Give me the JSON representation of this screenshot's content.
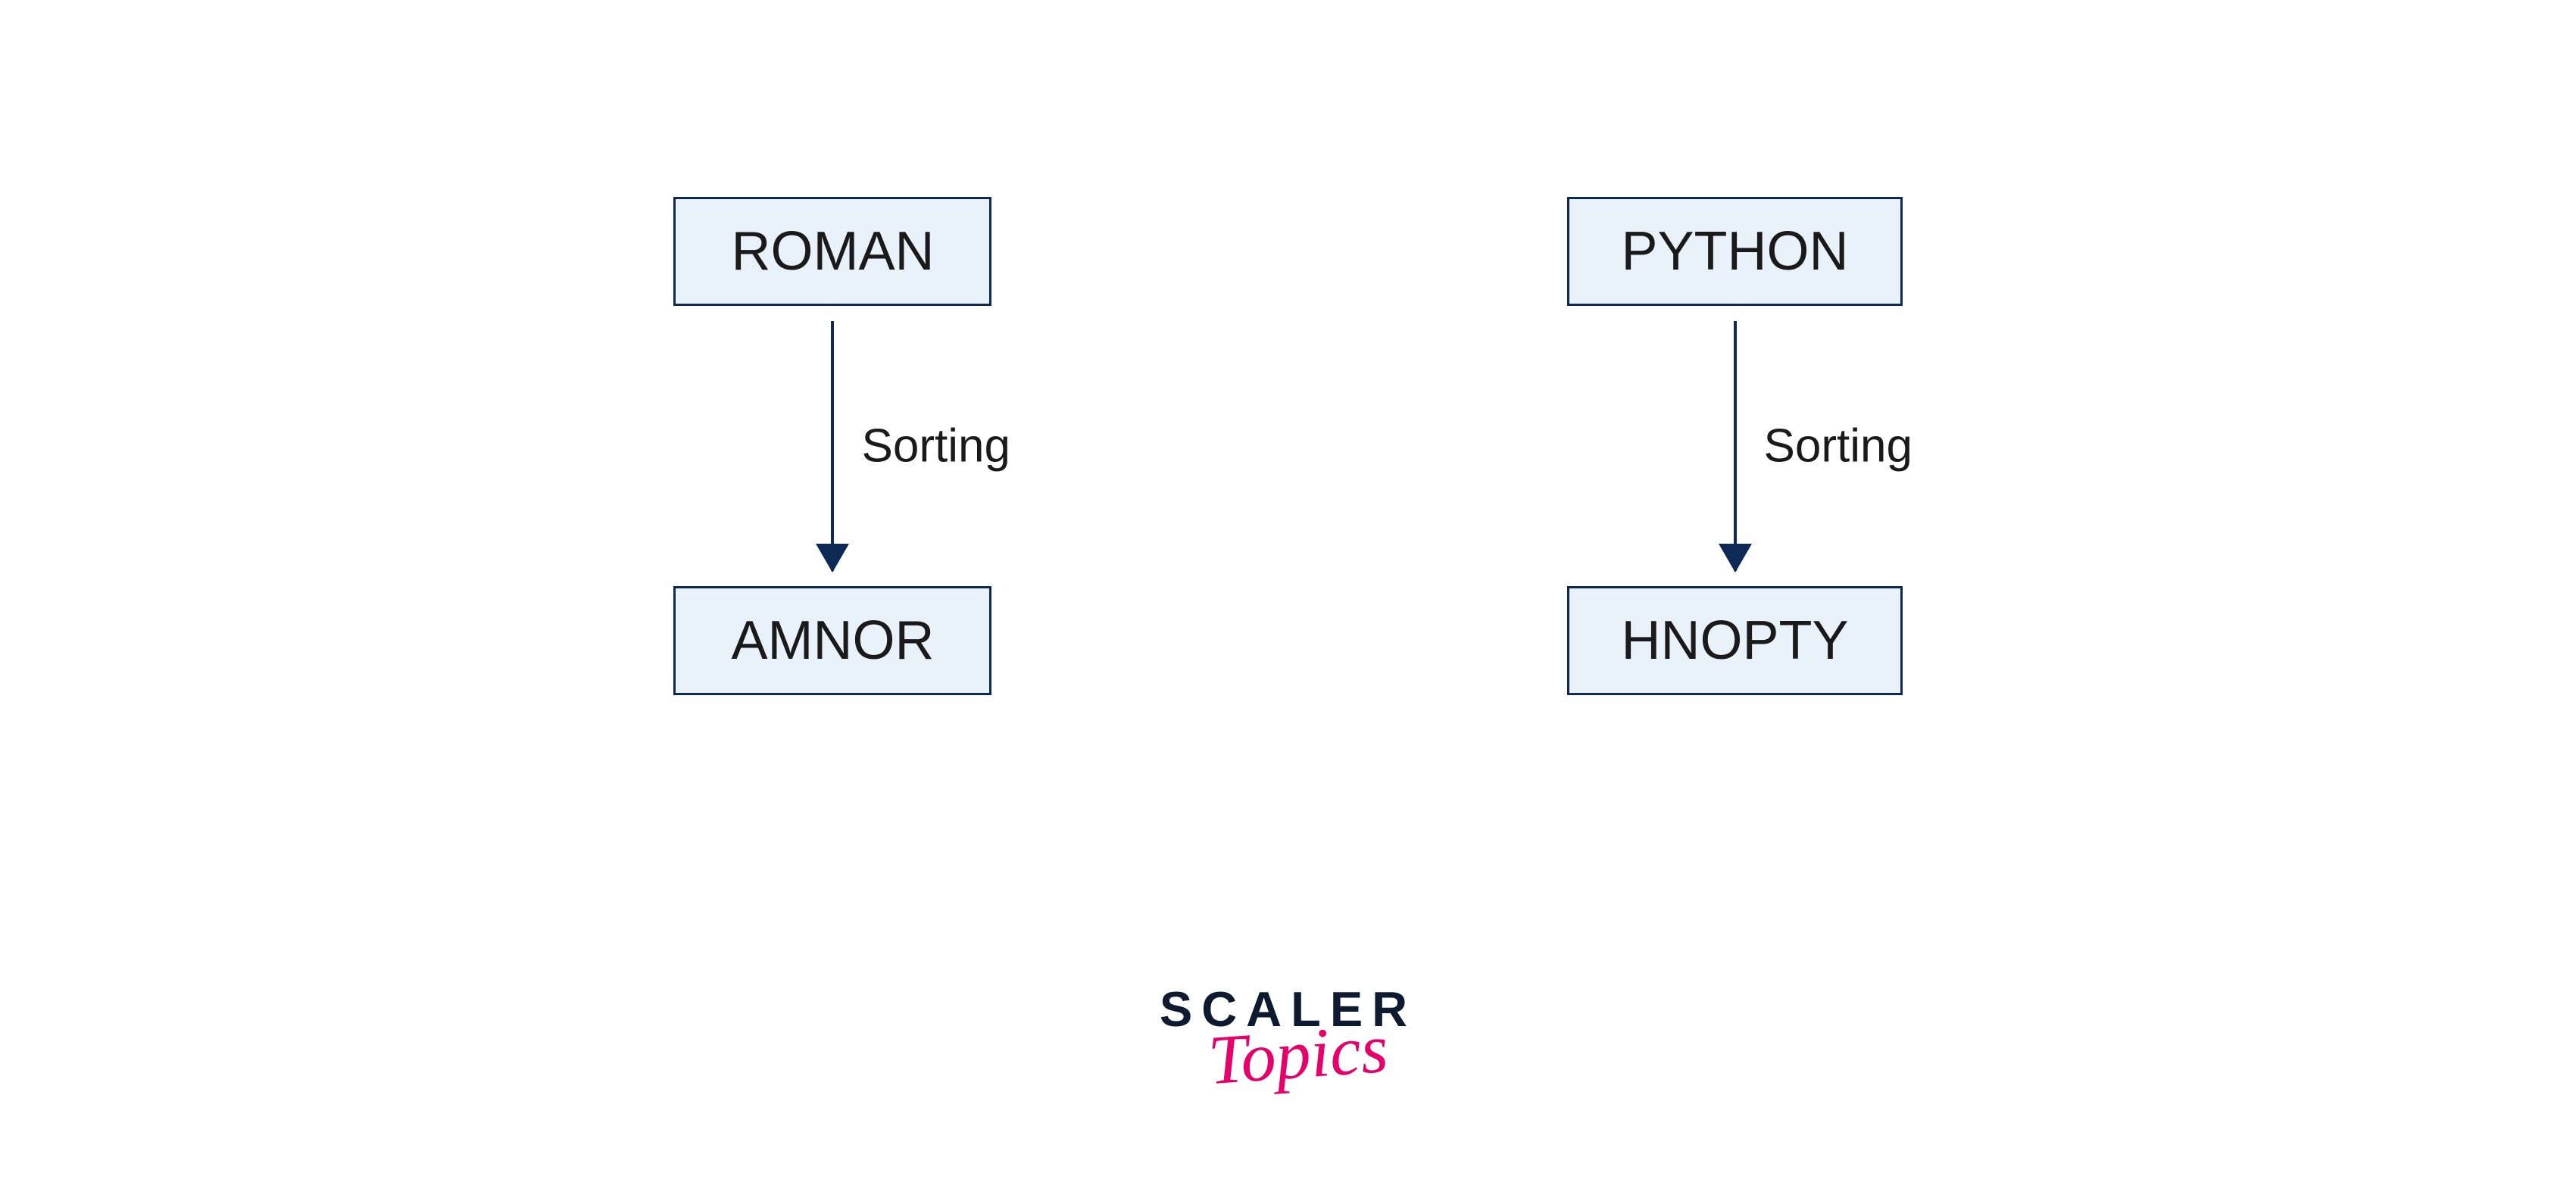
{
  "diagram": {
    "left": {
      "input": "ROMAN",
      "operation": "Sorting",
      "output": "AMNOR"
    },
    "right": {
      "input": "PYTHON",
      "operation": "Sorting",
      "output": "HNOPTY"
    }
  },
  "logo": {
    "line1": "SCALER",
    "line2": "Topics"
  },
  "colors": {
    "box_fill": "#e9f2fb",
    "box_border": "#0d2a57",
    "arrow": "#0d2a57",
    "logo_primary": "#0e1a2f",
    "logo_accent": "#e6006b"
  }
}
